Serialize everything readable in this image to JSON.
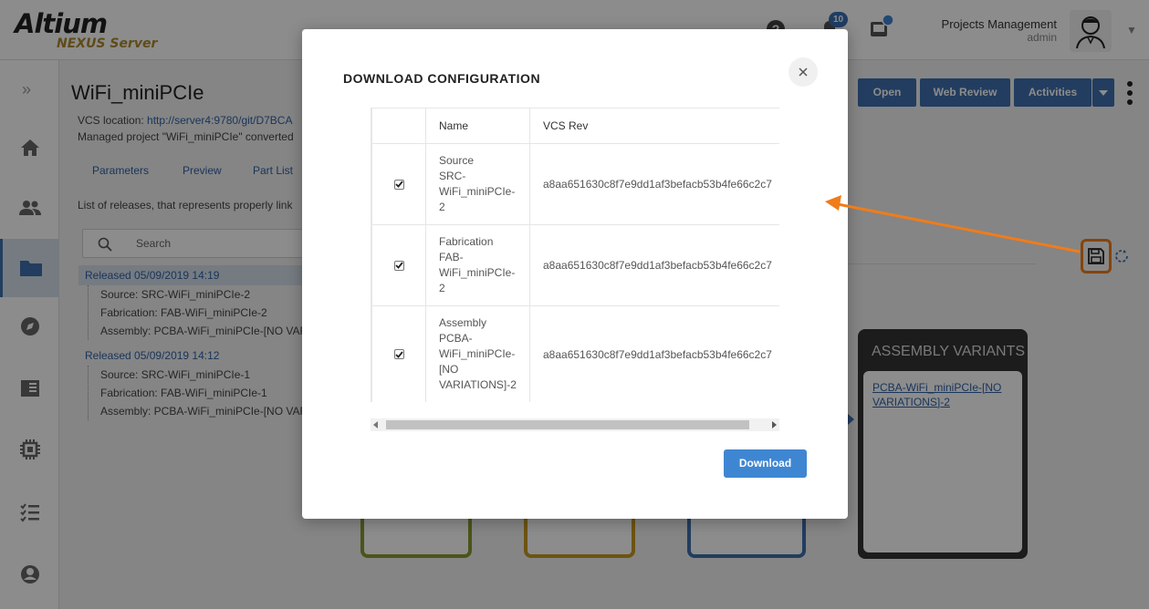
{
  "brand": {
    "name": "Altium",
    "product": "NEXUS Server"
  },
  "header": {
    "notification_count": "10",
    "user_name": "Projects Management",
    "user_role": "admin"
  },
  "project": {
    "title": "WiFi_miniPCIe",
    "vcs_label": "VCS location:",
    "vcs_url": "http://server4:9780/git/D7BCA",
    "managed_text": "Managed project \"WiFi_miniPCIe\" converted"
  },
  "tabs": [
    "Parameters",
    "Preview",
    "Part List"
  ],
  "releases": {
    "description": "List of releases, that represents properly link",
    "search_placeholder": "Search",
    "items": [
      {
        "label": "Released 05/09/2019 14:19",
        "children": [
          "Source: SRC-WiFi_miniPCIe-2",
          "Fabrication: FAB-WiFi_miniPCIe-2",
          "Assembly: PCBA-WiFi_miniPCIe-[NO VARI"
        ]
      },
      {
        "label": "Released 05/09/2019 14:12",
        "children": [
          "Source: SRC-WiFi_miniPCIe-1",
          "Fabrication: FAB-WiFi_miniPCIe-1",
          "Assembly: PCBA-WiFi_miniPCIe-[NO VAR"
        ]
      }
    ]
  },
  "actions": {
    "open": "Open",
    "web_review": "Web Review",
    "activities": "Activities"
  },
  "assembly_variants": {
    "title": "ASSEMBLY VARIANTS",
    "link": "PCBA-WiFi_miniPCIe-[NO VARIATIONS]-2"
  },
  "modal": {
    "title": "DOWNLOAD CONFIGURATION",
    "columns": {
      "name": "Name",
      "vcs_rev": "VCS Rev"
    },
    "rows": [
      {
        "checked": true,
        "name_lines": [
          "Source",
          "SRC-",
          "WiFi_miniPCIe-",
          "2"
        ],
        "vcs_rev": "a8aa651630c8f7e9dd1af3befacb53b4fe66c2c7"
      },
      {
        "checked": true,
        "name_lines": [
          "Fabrication",
          "FAB-",
          "WiFi_miniPCIe-",
          "2"
        ],
        "vcs_rev": "a8aa651630c8f7e9dd1af3befacb53b4fe66c2c7"
      },
      {
        "checked": true,
        "name_lines": [
          "Assembly",
          "PCBA-",
          "WiFi_miniPCIe-",
          "[NO",
          "VARIATIONS]-2"
        ],
        "vcs_rev": "a8aa651630c8f7e9dd1af3befacb53b4fe66c2c7"
      }
    ],
    "download_label": "Download"
  },
  "colors": {
    "primary": "#3f6fae",
    "download": "#3f86d2",
    "annotation": "#f07c1a",
    "flow_green": "#8a9a2e",
    "flow_gold": "#c69a22",
    "flow_blue": "#3f6fae"
  }
}
